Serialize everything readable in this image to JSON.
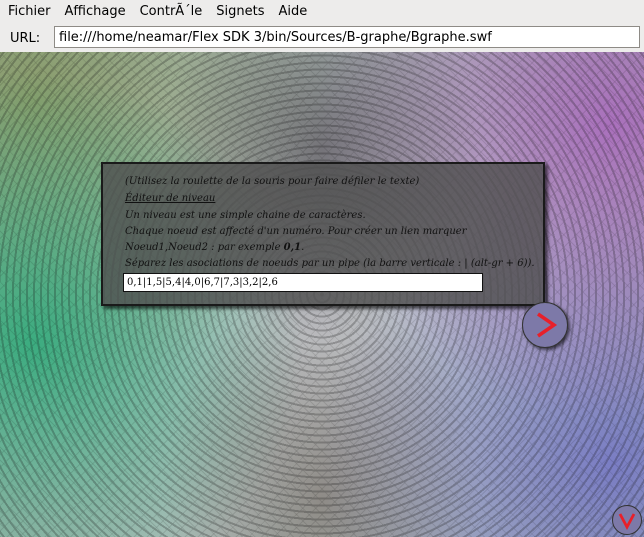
{
  "menu": {
    "items": [
      "Fichier",
      "Affichage",
      "ContrÃ´le",
      "Signets",
      "Aide"
    ]
  },
  "urlbar": {
    "label": "URL:",
    "value": "file:///home/neamar/Flex SDK 3/bin/Sources/B-graphe/Bgraphe.swf"
  },
  "dialog": {
    "hint": "(Utilisez la roulette de la souris pour faire défiler le texte)",
    "heading": "Éditeur de niveau",
    "line1": "Un niveau est une simple chaine de caractères.",
    "line2": "Chaque noeud est affecté d'un numéro. Pour créer un lien marquer",
    "line3_prefix": "Noeud1,Noeud2 : par exemple ",
    "line3_example": "0,1",
    "line3_suffix": ".",
    "line4": "Séparez les asociations de noeuds par un pipe (la barre verticale : | (alt-gr + 6)).",
    "level_value": "0,1|1,5|5,4|4,0|6,7|7,3|3,2|2,6"
  },
  "colors": {
    "button_fill": "#7d79a8",
    "arrow_red": "#e8202a"
  },
  "icons": {
    "next": "chevron-right-icon",
    "corner": "chevron-down-icon"
  }
}
